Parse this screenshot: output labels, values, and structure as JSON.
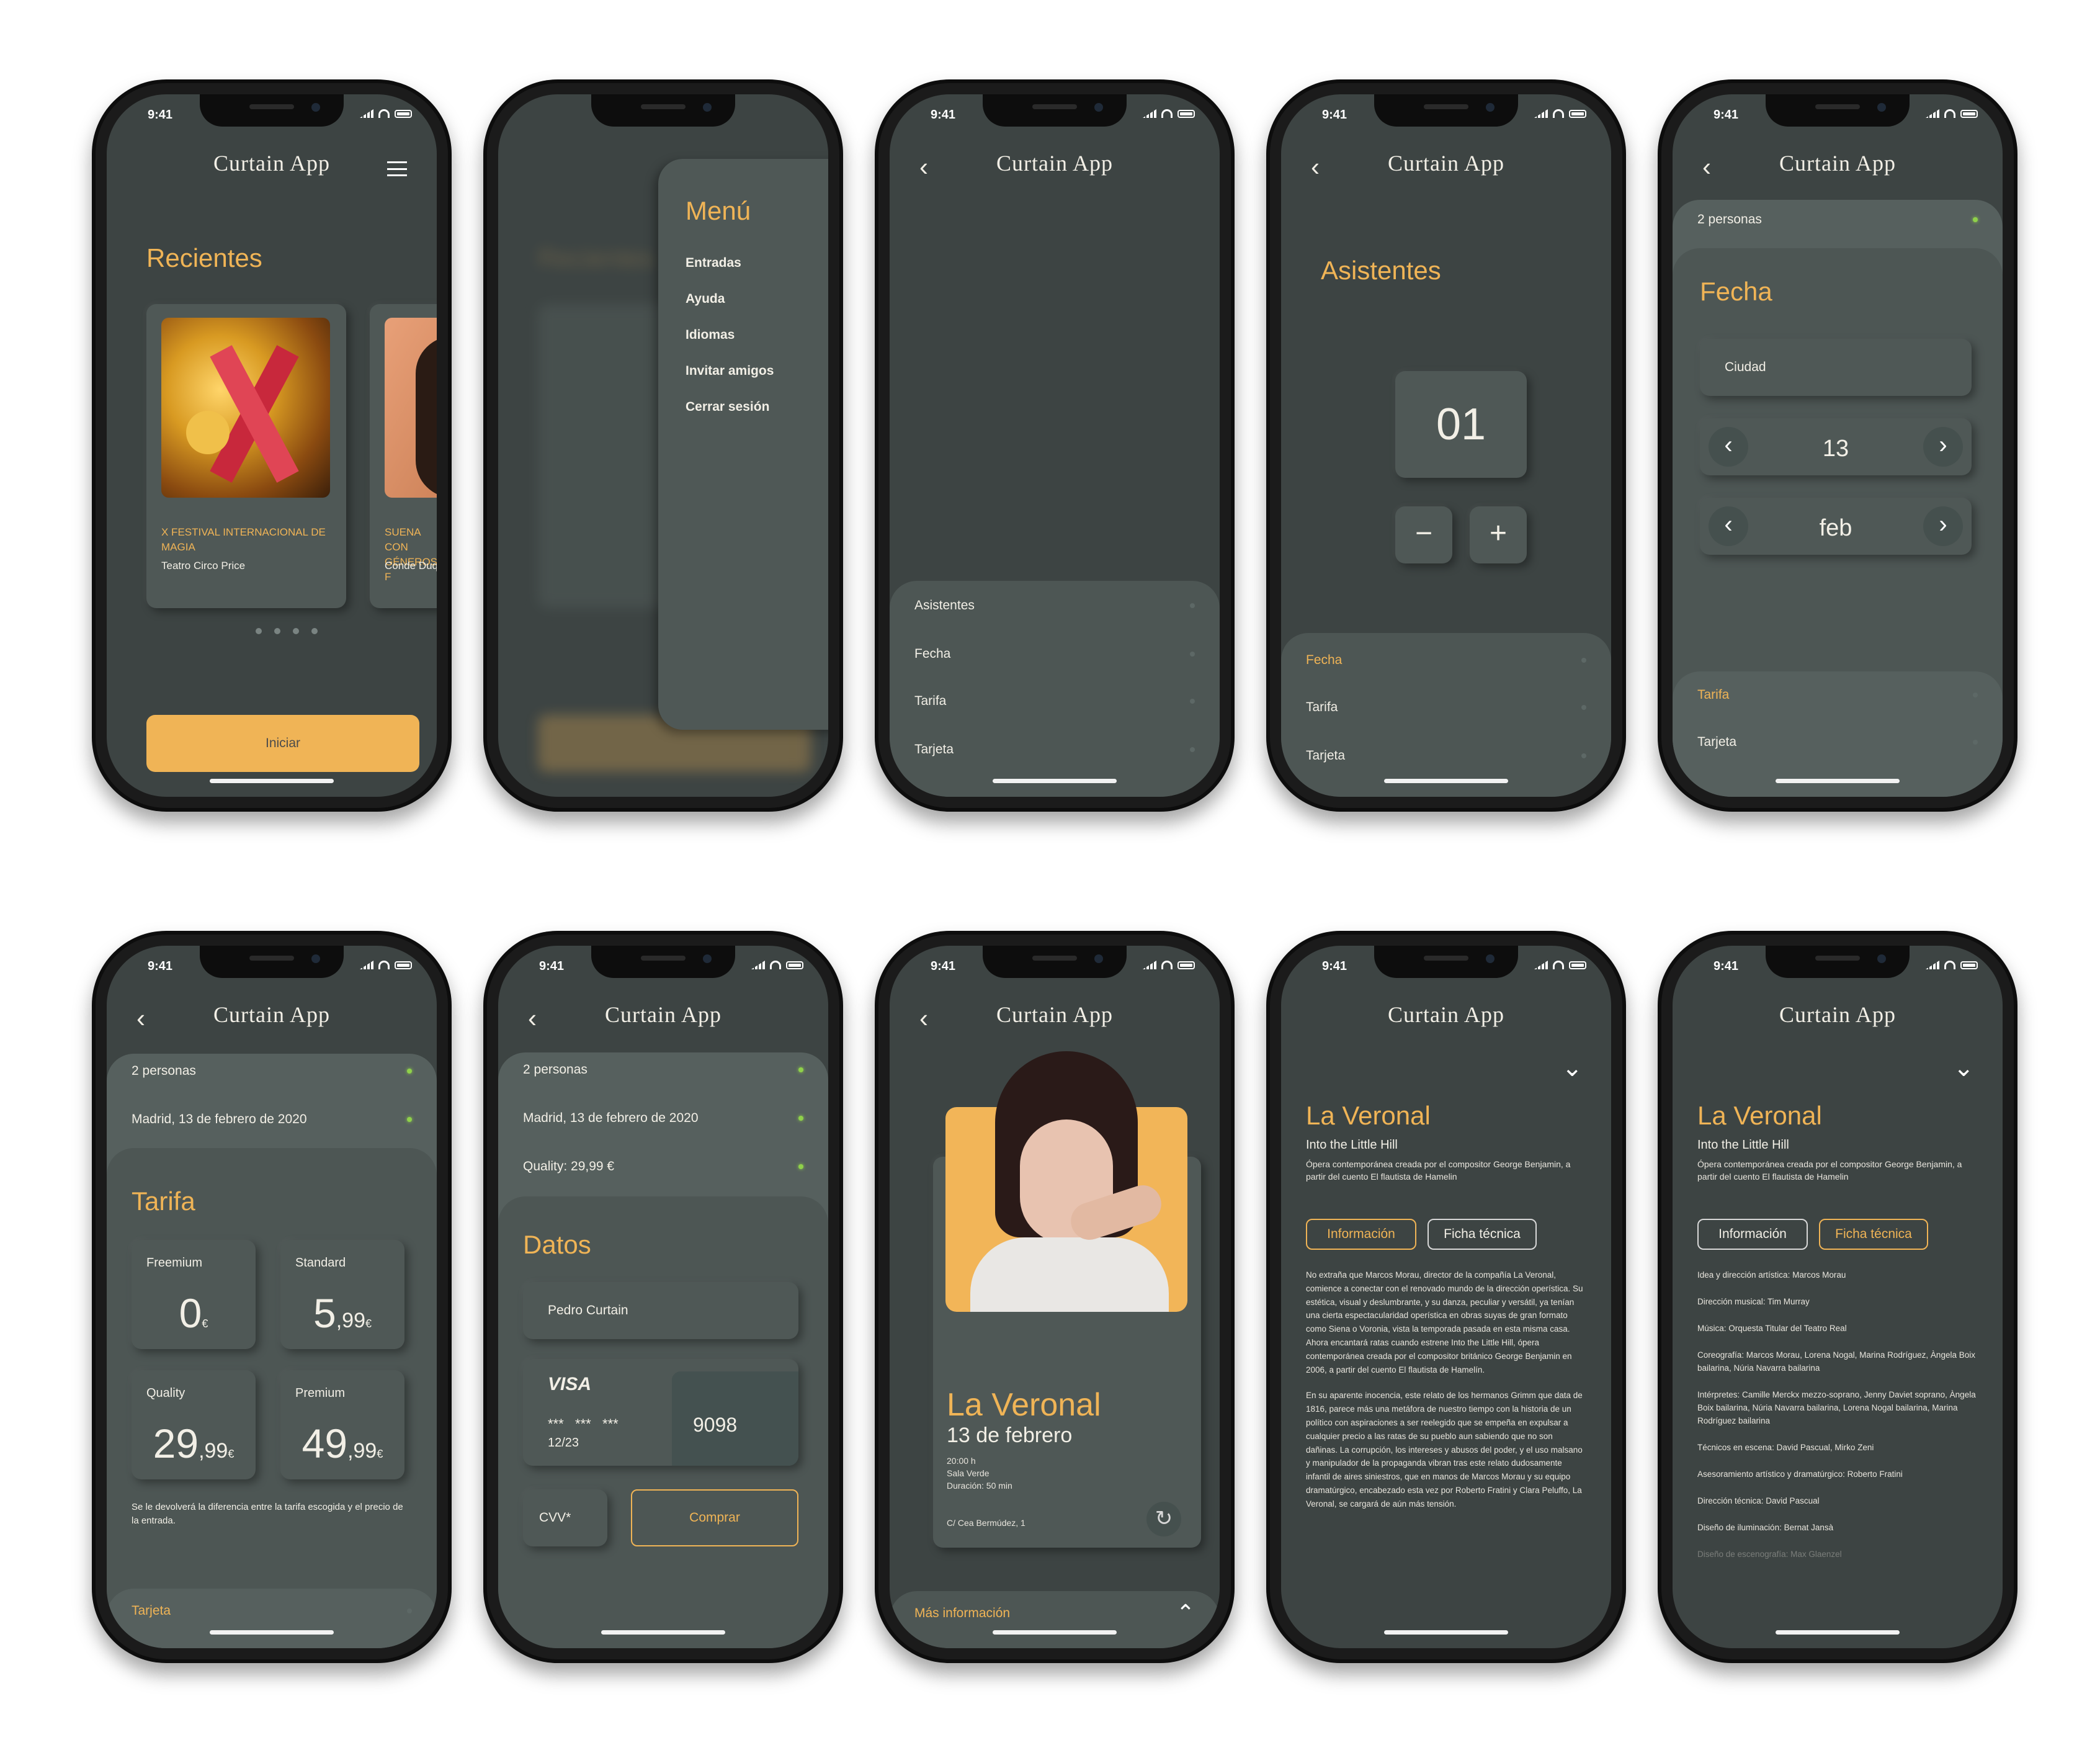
{
  "status": {
    "time": "9:41"
  },
  "brand": {
    "logo": "Curtain App"
  },
  "icons": {
    "back": "‹",
    "chevron_left": "‹",
    "chevron_right": "›",
    "chevron_down": "⌄",
    "chevron_up": "⌃",
    "minus": "−",
    "plus": "+",
    "refresh": "↻"
  },
  "s1": {
    "title": "Recientes",
    "card1": {
      "title": "X FESTIVAL INTERNACIONAL DE MAGIA",
      "venue": "Teatro Circo Price"
    },
    "card2": {
      "title": "SUENA CON GÉNEROS F",
      "venue": "Conde Duqu"
    },
    "start_label": "Iniciar"
  },
  "s2": {
    "title": "Menú",
    "items": [
      "Entradas",
      "Ayuda",
      "Idiomas",
      "Invitar amigos",
      "Cerrar sesión"
    ],
    "bg_title": "Recientes"
  },
  "s3": {
    "rows": [
      "Asistentes",
      "Fecha",
      "Tarifa",
      "Tarjeta"
    ]
  },
  "s4": {
    "title": "Asistentes",
    "count": "01",
    "rows": [
      "Fecha",
      "Tarifa",
      "Tarjeta"
    ]
  },
  "s5": {
    "summary": "2 personas",
    "title": "Fecha",
    "city_placeholder": "Ciudad",
    "day": "13",
    "month": "feb",
    "rows": [
      "Tarifa",
      "Tarjeta"
    ]
  },
  "s6": {
    "summary": [
      "2 personas",
      "Madrid, 13 de febrero de 2020"
    ],
    "title": "Tarifa",
    "rates": [
      {
        "name": "Freemium",
        "int": "0",
        "dec": "",
        "cur": "€"
      },
      {
        "name": "Standard",
        "int": "5",
        "dec": ",99",
        "cur": "€"
      },
      {
        "name": "Quality",
        "int": "29",
        "dec": ",99",
        "cur": "€"
      },
      {
        "name": "Premium",
        "int": "49",
        "dec": ",99",
        "cur": "€"
      }
    ],
    "note": "Se le devolverá la diferencia entre la tarifa escogida y el precio de la entrada.",
    "next_row": "Tarjeta"
  },
  "s7": {
    "summary": [
      "2 personas",
      "Madrid, 13 de febrero de 2020",
      "Quality: 29,99 €"
    ],
    "title": "Datos",
    "name_value": "Pedro Curtain",
    "card": {
      "brand": "VISA",
      "masked": "***   ***   ***",
      "last": "9098",
      "expiry": "12/23"
    },
    "cvv_placeholder": "CVV*",
    "buy_label": "Comprar"
  },
  "s8": {
    "title": "La Veronal",
    "date": "13 de febrero",
    "time": "20:00 h",
    "room": "Sala Verde",
    "duration": "Duración: 50 min",
    "address": "C/ Cea Bermúdez, 1",
    "more": "Más información"
  },
  "s9": {
    "title": "La Veronal",
    "subtitle": "Into the Little Hill",
    "desc": "Ópera contemporánea creada por el compositor George Benjamin, a partir del cuento El flautista de Hamelin",
    "tab_info": "Información",
    "tab_tech": "Ficha técnica",
    "p1": "No extraña que Marcos Morau, director de la compañía La Veronal, comience a conectar con el renovado mundo de la dirección operística. Su estética, visual y deslumbrante, y su danza, peculiar y versátil, ya tenían una cierta espectacularidad operística en obras suyas de gran formato como Siena o Voronia, vista la temporada pasada en esta misma casa. Ahora encantará ratas cuando estrene Into the Little Hill, ópera contemporánea creada por el compositor británico George Benjamin en 2006, a partir del cuento El flautista de Hamelín.",
    "p2": "En su aparente inocencia, este relato de los hermanos Grimm que data de 1816, parece más una metáfora de nuestro tiempo con la historia de un político con aspiraciones a ser reelegido que se empeña en expulsar a cualquier precio a las ratas de su pueblo aun sabiendo que no son dañinas. La corrupción, los intereses y abusos del poder, y el uso malsano y manipulador de la propaganda vibran tras este relato dudosamente infantil de aires siniestros, que en manos de Marcos Morau y su equipo dramatúrgico, encabezado esta vez por Roberto Fratini y Clara Peluffo, La Veronal, se cargará de aún más tensión."
  },
  "s10": {
    "title": "La Veronal",
    "subtitle": "Into the Little Hill",
    "desc": "Ópera contemporánea creada por el compositor George Benjamin, a partir del cuento El flautista de Hamelin",
    "tab_info": "Información",
    "tab_tech": "Ficha técnica",
    "credits": [
      "Idea y dirección artística: Marcos Morau",
      "Dirección musical: Tim Murray",
      "Música: Orquesta Titular del Teatro Real",
      "Coreografía: Marcos Morau, Lorena Nogal, Marina Rodríguez, Àngela Boix bailarina, Núria Navarra bailarina",
      "Intérpretes: Camille Merckx mezzo-soprano, Jenny Daviet soprano, Àngela Boix bailarina, Núria Navarra bailarina, Lorena Nogal bailarina, Marina Rodríguez bailarina",
      "Técnicos en escena: David Pascual, Mirko Zeni",
      "Asesoramiento artístico y dramatúrgico: Roberto Fratini",
      "Dirección técnica: David Pascual",
      "Diseño de iluminación: Bernat Jansà",
      "Diseño de escenografía: Max Glaenzel"
    ]
  }
}
